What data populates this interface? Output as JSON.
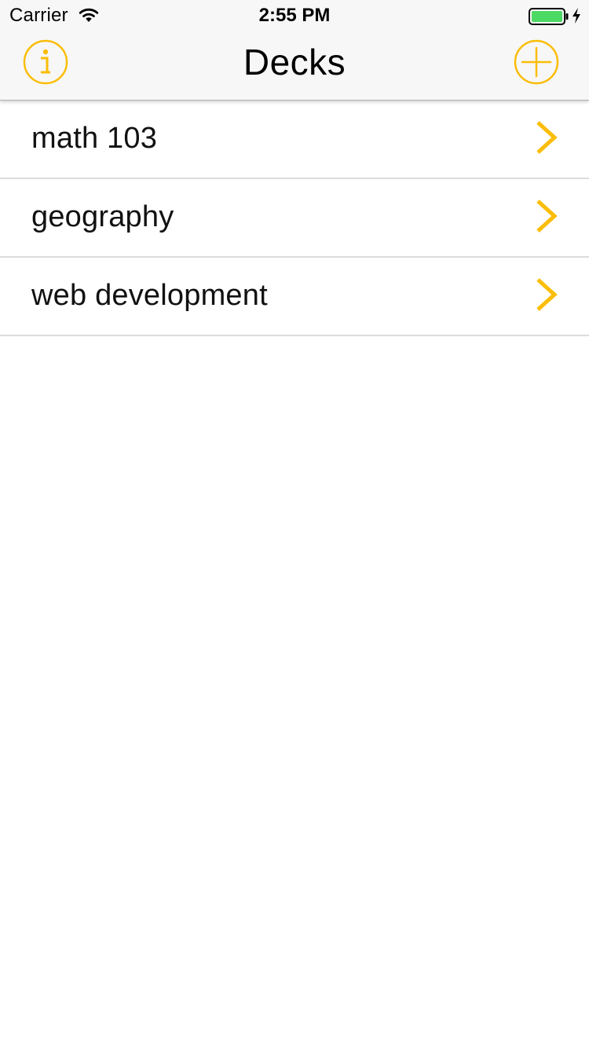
{
  "status_bar": {
    "carrier": "Carrier",
    "time": "2:55 PM",
    "battery_color": "#4cd964"
  },
  "nav": {
    "title": "Decks",
    "left_icon": "info-circle-icon",
    "right_icon": "plus-circle-icon"
  },
  "decks": [
    {
      "label": "math 103"
    },
    {
      "label": "geography"
    },
    {
      "label": "web development"
    }
  ],
  "colors": {
    "accent": "#fbbd09",
    "separator": "#dcdcdc",
    "bar_background": "#f7f7f7"
  }
}
